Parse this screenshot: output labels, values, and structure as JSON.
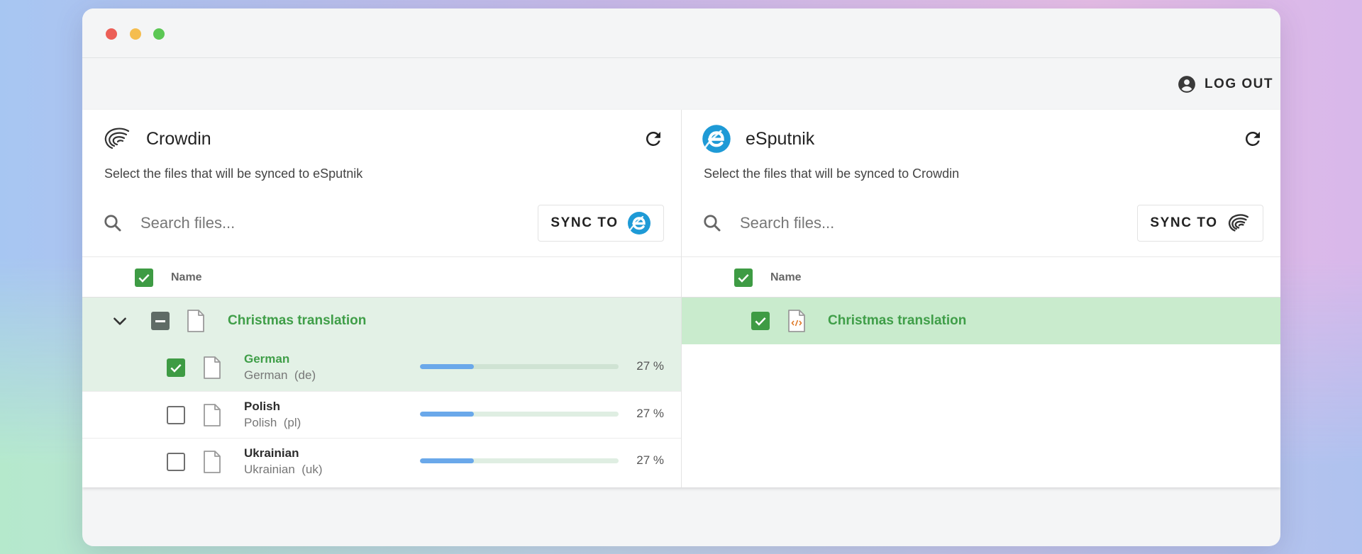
{
  "header": {
    "logout_label": "LOG OUT"
  },
  "left": {
    "title": "Crowdin",
    "subtitle": "Select the files that will be synced to eSputnik",
    "search_placeholder": "Search files...",
    "sync_label": "SYNC TO",
    "name_column": "Name",
    "parent_file": "Christmas translation",
    "languages": [
      {
        "name": "German",
        "display": "German",
        "code": "(de)",
        "progress": 27,
        "progress_label": "27 %",
        "checked": true
      },
      {
        "name": "Polish",
        "display": "Polish",
        "code": "(pl)",
        "progress": 27,
        "progress_label": "27 %",
        "checked": false
      },
      {
        "name": "Ukrainian",
        "display": "Ukrainian",
        "code": "(uk)",
        "progress": 27,
        "progress_label": "27 %",
        "checked": false
      }
    ]
  },
  "right": {
    "title": "eSputnik",
    "subtitle": "Select the files that will be synced to Crowdin",
    "search_placeholder": "Search files...",
    "sync_label": "SYNC TO",
    "name_column": "Name",
    "file": "Christmas translation"
  },
  "colors": {
    "accent_green": "#3e9b44",
    "progress_blue": "#6aa8ea",
    "esputnik_blue": "#1e9ad6",
    "selected_row": "#e3f1e6",
    "selected_row_strong": "#c9ebcd"
  },
  "icons": {
    "user": "account-circle-icon",
    "refresh": "refresh-icon",
    "search": "search-icon",
    "chevron": "chevron-down-icon",
    "file": "file-icon",
    "html_file": "html-file-icon"
  }
}
